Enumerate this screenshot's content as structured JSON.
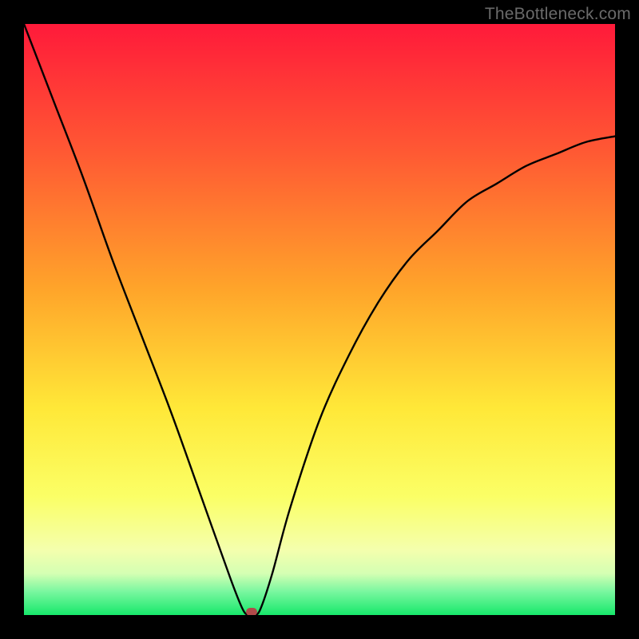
{
  "watermark": "TheBottleneck.com",
  "chart_data": {
    "type": "line",
    "title": "",
    "xlabel": "",
    "ylabel": "",
    "xlim": [
      0,
      100
    ],
    "ylim": [
      0,
      100
    ],
    "series": [
      {
        "name": "bottleneck-curve",
        "x": [
          0,
          5,
          10,
          15,
          20,
          25,
          30,
          35,
          37,
          38,
          39,
          40,
          42,
          45,
          50,
          55,
          60,
          65,
          70,
          75,
          80,
          85,
          90,
          95,
          100
        ],
        "values": [
          100,
          87,
          74,
          60,
          47,
          34,
          20,
          6,
          1,
          0,
          0,
          1,
          7,
          18,
          33,
          44,
          53,
          60,
          65,
          70,
          73,
          76,
          78,
          80,
          81
        ]
      }
    ],
    "marker": {
      "x": 38.5,
      "y": 0.5,
      "color": "#b14a4a"
    },
    "gradient_stops": [
      {
        "pct": 0,
        "color": "#ff1a3a"
      },
      {
        "pct": 22,
        "color": "#ff5a33"
      },
      {
        "pct": 45,
        "color": "#ffa52a"
      },
      {
        "pct": 65,
        "color": "#ffe838"
      },
      {
        "pct": 80,
        "color": "#fbff66"
      },
      {
        "pct": 89,
        "color": "#f4ffad"
      },
      {
        "pct": 93,
        "color": "#d4ffb3"
      },
      {
        "pct": 96,
        "color": "#7af7a0"
      },
      {
        "pct": 100,
        "color": "#17e86b"
      }
    ],
    "colors": {
      "frame": "#000000",
      "curve": "#000000"
    }
  }
}
